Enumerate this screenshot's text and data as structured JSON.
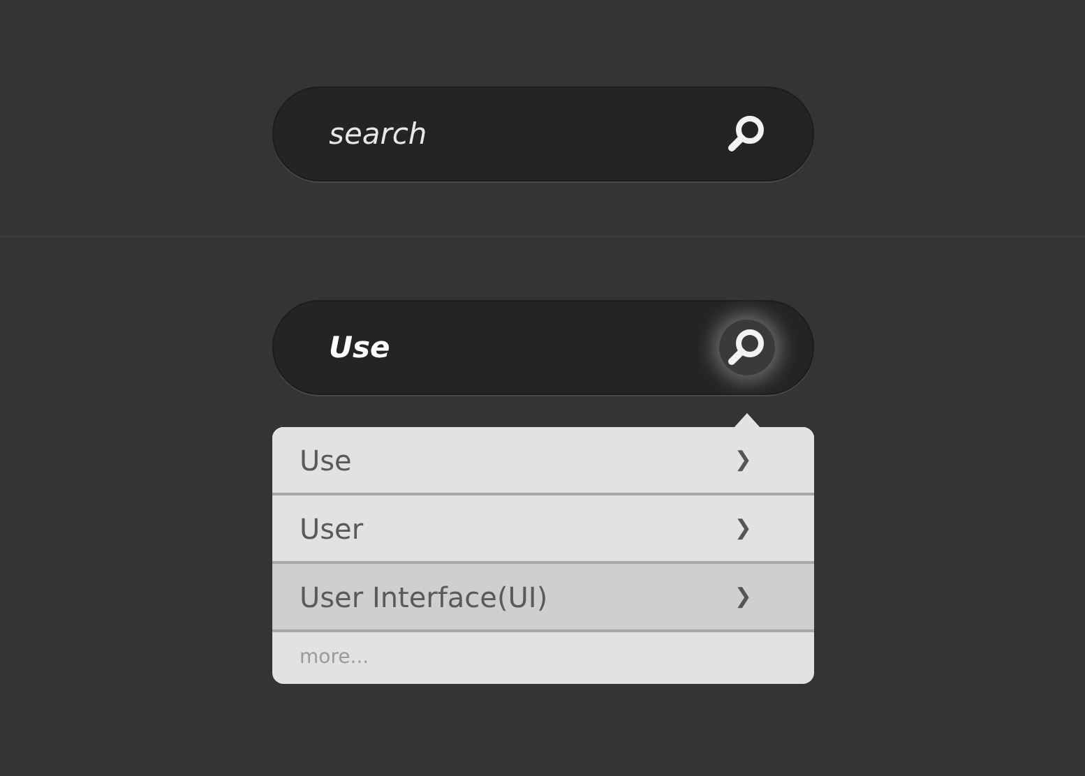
{
  "search_fields": [
    {
      "placeholder": "search",
      "focused": false
    },
    {
      "value": "Use",
      "focused": true
    }
  ],
  "suggestions": {
    "items": [
      {
        "label": "Use",
        "chevron": "❯",
        "selected": false
      },
      {
        "label": "User",
        "chevron": "❯",
        "selected": false
      },
      {
        "label": "User Interface(UI)",
        "chevron": "❯",
        "selected": true
      }
    ],
    "more": "more..."
  }
}
